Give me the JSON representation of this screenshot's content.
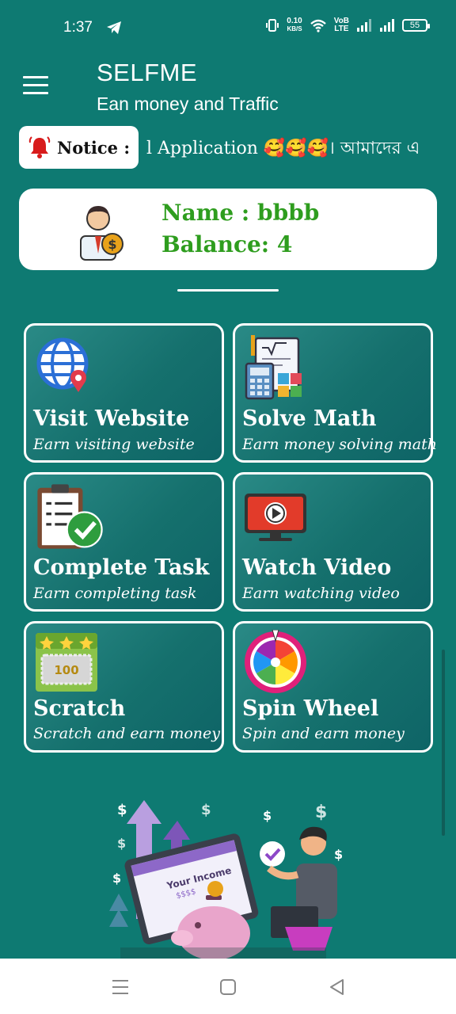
{
  "status_bar": {
    "time": "1:37",
    "net_speed_value": "0.10",
    "net_speed_unit": "KB/S",
    "volte_top": "VoB",
    "volte_bottom": "LTE",
    "battery": "55"
  },
  "app_bar": {
    "title": "SELFME",
    "subtitle": "Ean money and Traffic"
  },
  "notice": {
    "label": "Notice :",
    "marquee_text": "l Application  🥰🥰🥰। আমাদের এ"
  },
  "profile": {
    "name": "Name : bbbb",
    "balance": "Balance: 4"
  },
  "cards": [
    {
      "title": "Visit Website",
      "subtitle": "Earn visiting website",
      "icon": "globe-location-icon"
    },
    {
      "title": "Solve Math",
      "subtitle": "Earn money solving math",
      "icon": "calculator-math-icon"
    },
    {
      "title": "Complete Task",
      "subtitle": "Earn completing task",
      "icon": "clipboard-check-icon"
    },
    {
      "title": "Watch Video",
      "subtitle": "Earn watching video",
      "icon": "video-play-icon"
    },
    {
      "title": "Scratch",
      "subtitle": "Scratch and earn money",
      "icon": "scratch-card-icon"
    },
    {
      "title": "Spin Wheel",
      "subtitle": "Spin and earn money",
      "icon": "spin-wheel-icon"
    }
  ],
  "illustration": {
    "screen_text": "Your Income",
    "screen_amount": "$$$$"
  },
  "colors": {
    "background": "#0e7a72",
    "accent_green": "#2e9d1e",
    "card_border": "#ffffff"
  }
}
